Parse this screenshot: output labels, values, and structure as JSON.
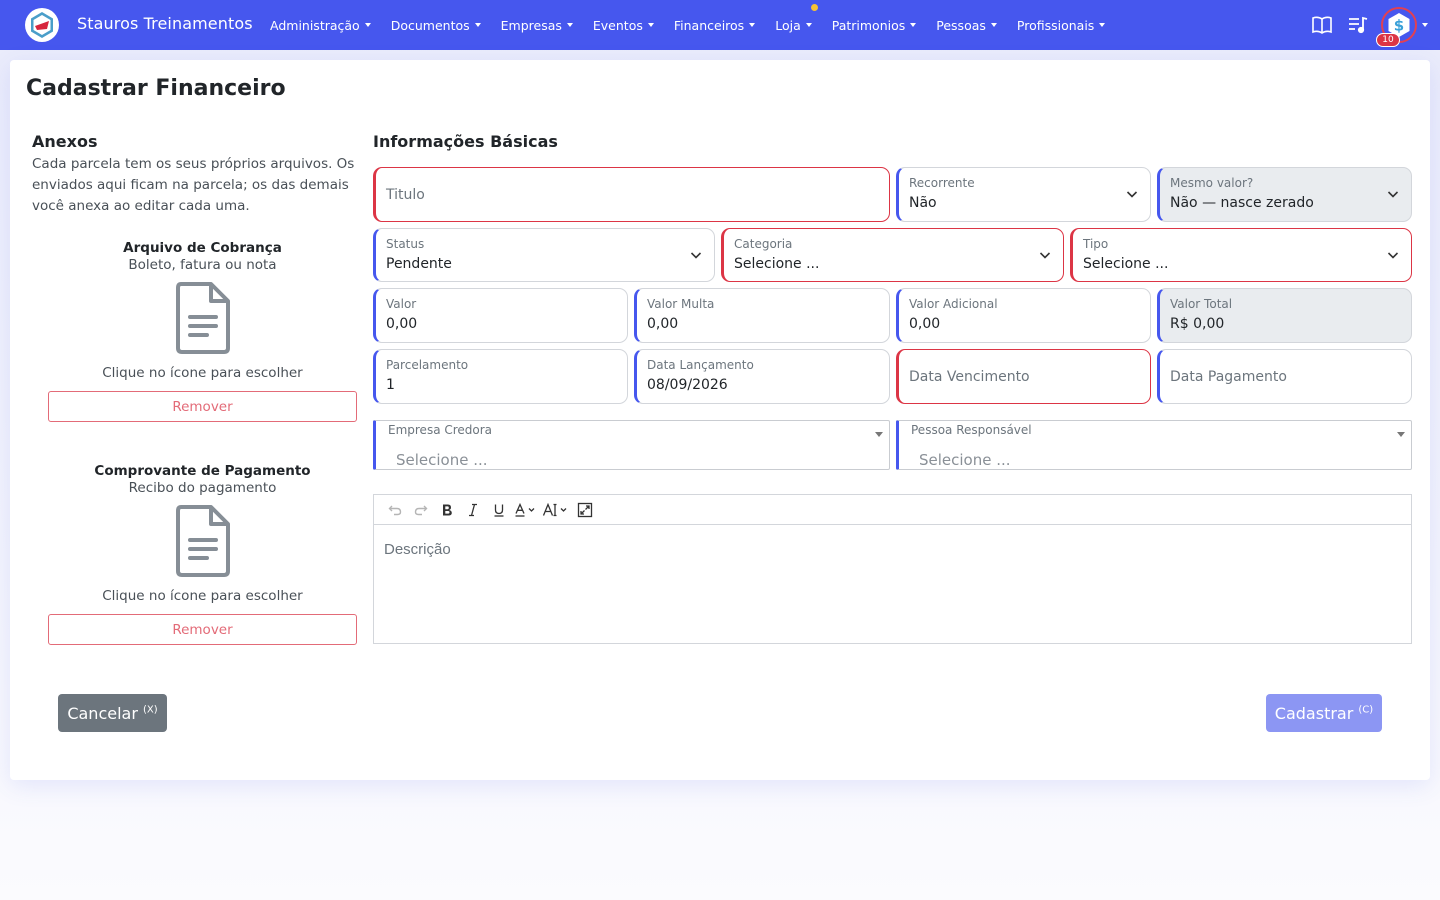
{
  "colors": {
    "primary": "#4657ee",
    "danger": "#dc3545",
    "secondary": "#6c757d",
    "warning_dot": "#f7c235"
  },
  "navbar": {
    "brand": "Stauros Treinamentos",
    "menu": [
      {
        "label": "Administração"
      },
      {
        "label": "Documentos"
      },
      {
        "label": "Empresas"
      },
      {
        "label": "Eventos"
      },
      {
        "label": "Financeiros"
      },
      {
        "label": "Loja"
      },
      {
        "label": "Patrimonios"
      },
      {
        "label": "Pessoas"
      },
      {
        "label": "Profissionais"
      }
    ],
    "icons": [
      "book-open-icon",
      "music-list-icon"
    ],
    "notification_count": "10"
  },
  "page": {
    "title": "Cadastrar Financeiro"
  },
  "anexos": {
    "title": "Anexos",
    "description": "Cada parcela tem os seus próprios arquivos. Os enviados aqui ficam na parcela; os das demais você anexa ao editar cada uma.",
    "items": [
      {
        "title": "Arquivo de Cobrança",
        "subtitle": "Boleto, fatura ou nota",
        "hint": "Clique no ícone para escolher",
        "remove": "Remover"
      },
      {
        "title": "Comprovante de Pagamento",
        "subtitle": "Recibo do pagamento",
        "hint": "Clique no ícone para escolher",
        "remove": "Remover"
      }
    ]
  },
  "form": {
    "section_title": "Informações Básicas",
    "titulo": {
      "placeholder": "Titulo"
    },
    "recorrente": {
      "label": "Recorrente",
      "value": "Não"
    },
    "mesmo_valor": {
      "label": "Mesmo valor?",
      "value": "Não — nasce zerado"
    },
    "status": {
      "label": "Status",
      "value": "Pendente"
    },
    "categoria": {
      "label": "Categoria",
      "value": "Selecione ..."
    },
    "tipo": {
      "label": "Tipo",
      "value": "Selecione ..."
    },
    "valor": {
      "label": "Valor",
      "value": "0,00"
    },
    "valor_multa": {
      "label": "Valor Multa",
      "value": "0,00"
    },
    "valor_adicional": {
      "label": "Valor Adicional",
      "value": "0,00"
    },
    "valor_total": {
      "label": "Valor Total",
      "value": "R$ 0,00"
    },
    "parcelamento": {
      "label": "Parcelamento",
      "value": "1"
    },
    "data_lancamento": {
      "label": "Data Lançamento",
      "value": "08/09/2026"
    },
    "data_vencimento": {
      "placeholder": "Data Vencimento"
    },
    "data_pagamento": {
      "placeholder": "Data Pagamento"
    },
    "empresa_credora": {
      "label": "Empresa Credora",
      "placeholder": "Selecione ..."
    },
    "pessoa_responsavel": {
      "label": "Pessoa Responsável",
      "placeholder": "Selecione ..."
    },
    "descricao": {
      "placeholder": "Descrição"
    }
  },
  "actions": {
    "cancel": "Cancelar",
    "cancel_key": "(X)",
    "submit": "Cadastrar",
    "submit_key": "(C)"
  }
}
